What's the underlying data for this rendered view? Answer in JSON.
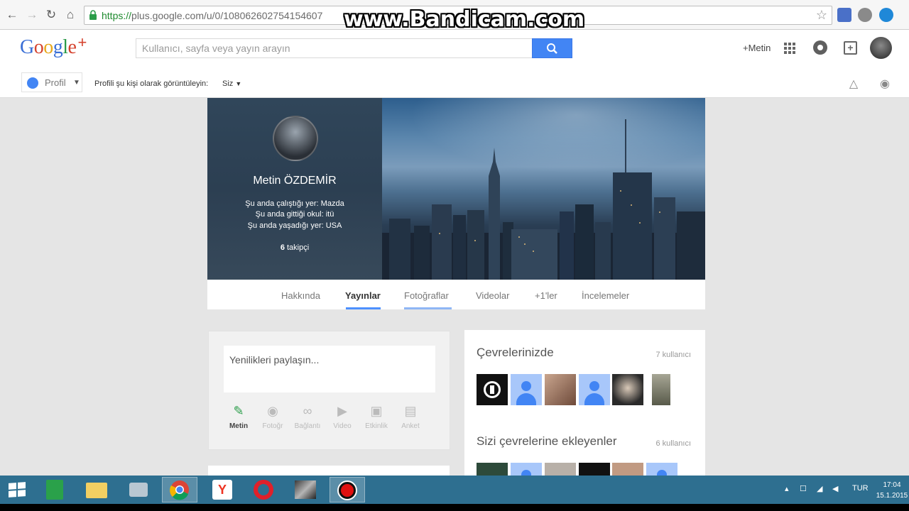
{
  "browser": {
    "url_scheme": "https://",
    "url_rest": "plus.google.com/u/0/108062602754154607",
    "watermark": "www.Bandicam.com"
  },
  "header": {
    "logo_letters": [
      "G",
      "o",
      "o",
      "g",
      "l",
      "e"
    ],
    "logo_plus": "+",
    "search_placeholder": "Kullanıcı, sayfa veya yayın arayın",
    "plus_user": "+Metin"
  },
  "subbar": {
    "profile_label": "Profil",
    "view_as_label": "Profili şu kişi olarak görüntüleyin:",
    "view_as_value": "Siz"
  },
  "profile": {
    "name": "Metin ÖZDEMİR",
    "work": "Şu anda çalıştığı yer: Mazda",
    "school": "Şu anda gittiği okul: itü",
    "lives": "Şu anda yaşadığı yer: USA",
    "followers_count": "6",
    "followers_label": "takipçi"
  },
  "tabs": [
    {
      "label": "Hakkında"
    },
    {
      "label": "Yayınlar"
    },
    {
      "label": "Fotoğraflar"
    },
    {
      "label": "Videolar"
    },
    {
      "label": "+1'ler"
    },
    {
      "label": "İncelemeler"
    }
  ],
  "share": {
    "placeholder": "Yenilikleri paylaşın...",
    "actions": [
      {
        "label": "Metin",
        "icon": "pencil-icon"
      },
      {
        "label": "Fotoğr",
        "icon": "camera-icon"
      },
      {
        "label": "Bağlantı",
        "icon": "link-icon"
      },
      {
        "label": "Video",
        "icon": "video-icon"
      },
      {
        "label": "Etkinlik",
        "icon": "calendar-icon"
      },
      {
        "label": "Anket",
        "icon": "poll-icon"
      }
    ]
  },
  "circles": {
    "in_circles_title": "Çevrelerinizde",
    "in_circles_count": "7 kullanıcı",
    "added_you_title": "Sizi çevrelerine ekleyenler",
    "added_you_count": "6 kullanıcı"
  },
  "taskbar": {
    "language": "TUR",
    "time": "17:04",
    "date": "15.1.2015"
  },
  "colors": {
    "accent": "#4285f4",
    "taskbar": "#2e6f90",
    "active_action": "#2a9d49"
  }
}
